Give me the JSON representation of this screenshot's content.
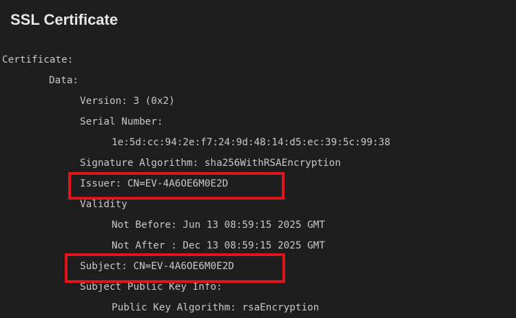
{
  "title": "SSL Certificate",
  "certificate": {
    "header": "Certificate:",
    "data_label": "Data:",
    "version": "Version: 3 (0x2)",
    "serial_label": "Serial Number:",
    "serial_value": "1e:5d:cc:94:2e:f7:24:9d:48:14:d5:ec:39:5c:99:38",
    "signature_algorithm": "Signature Algorithm: sha256WithRSAEncryption",
    "issuer": "Issuer: CN=EV-4A6OE6M0E2D",
    "validity_label": "Validity",
    "not_before": "Not Before: Jun 13 08:59:15 2025 GMT",
    "not_after": "Not After : Dec 13 08:59:15 2025 GMT",
    "subject": "Subject: CN=EV-4A6OE6M0E2D",
    "subject_pk_info": "Subject Public Key Info:",
    "public_key_algorithm": "Public Key Algorithm: rsaEncryption"
  },
  "annotation_color": "#e0141b"
}
